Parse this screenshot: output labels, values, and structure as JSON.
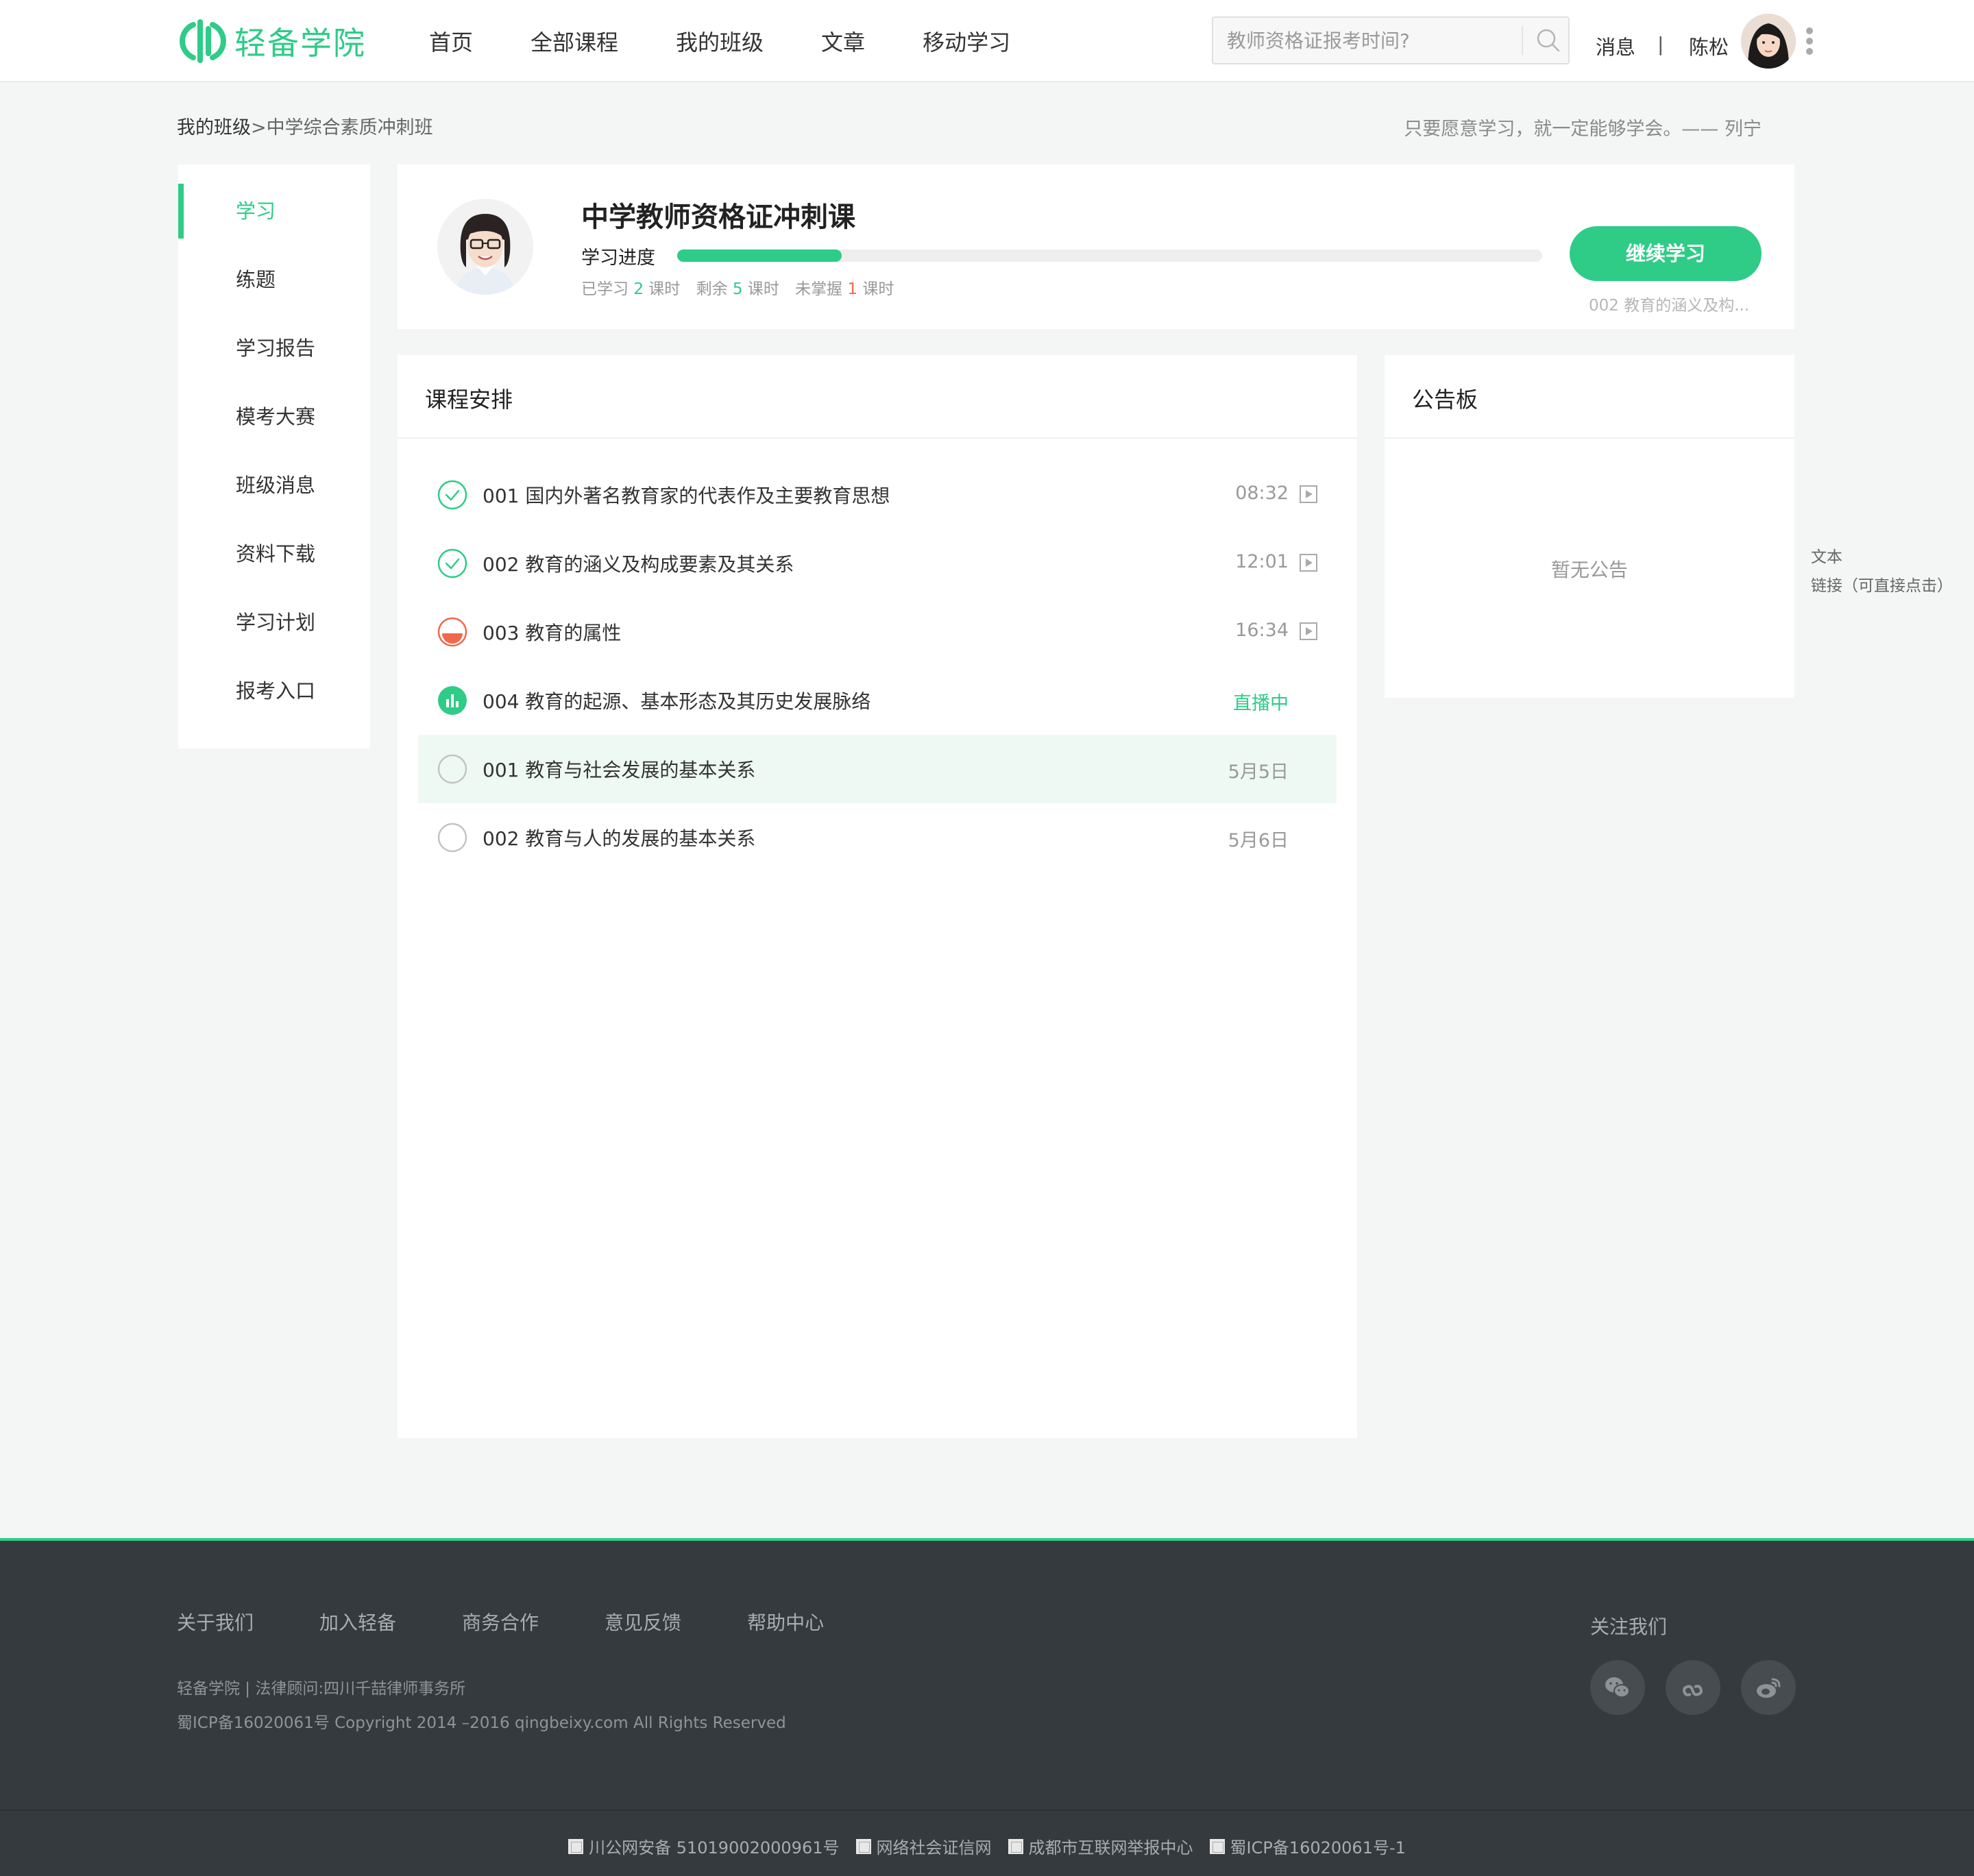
{
  "brand": {
    "name": "轻备学院",
    "color": "#2ecc87"
  },
  "nav": {
    "items": [
      "首页",
      "全部课程",
      "我的班级",
      "文章",
      "移动学习"
    ]
  },
  "search": {
    "placeholder": "教师资格证报考时间?"
  },
  "user": {
    "messages_label": "消息",
    "separator": "|",
    "name": "陈松"
  },
  "breadcrumb": {
    "home": "我的班级",
    "sep": ">",
    "current": "中学综合素质冲刺班"
  },
  "quote": "只要愿意学习，就一定能够学会。—— 列宁",
  "sidebar": {
    "items": [
      {
        "label": "学习",
        "active": true
      },
      {
        "label": "练题"
      },
      {
        "label": "学习报告"
      },
      {
        "label": "模考大赛"
      },
      {
        "label": "班级消息"
      },
      {
        "label": "资料下载"
      },
      {
        "label": "学习计划"
      },
      {
        "label": "报考入口"
      }
    ]
  },
  "course": {
    "title": "中学教师资格证冲刺课",
    "progress_label": "学习进度",
    "progress_fraction": 0.19,
    "stats": {
      "learned_prefix": "已学习",
      "learned": "2",
      "unit1": "课时",
      "remain_prefix": "剩余",
      "remain": "5",
      "unit2": "课时",
      "weak_prefix": "未掌握",
      "weak": "1",
      "unit3": "课时"
    },
    "continue_label": "继续学习",
    "continue_sub": "002 教育的涵义及构..."
  },
  "schedule": {
    "title": "课程安排",
    "lessons": [
      {
        "title": "001 国内外著名教育家的代表作及主要教育思想",
        "meta": "08:32",
        "status": "done",
        "play": true
      },
      {
        "title": "002 教育的涵义及构成要素及其关系",
        "meta": "12:01",
        "status": "done",
        "play": true
      },
      {
        "title": "003 教育的属性",
        "meta": "16:34",
        "status": "partial",
        "play": true
      },
      {
        "title": "004 教育的起源、基本形态及其历史发展脉络",
        "meta": "直播中",
        "status": "live",
        "play": false
      },
      {
        "title": "001 教育与社会发展的基本关系",
        "meta": "5月5日",
        "status": "todo",
        "play": false,
        "highlight": true
      },
      {
        "title": "002 教育与人的发展的基本关系",
        "meta": "5月6日",
        "status": "todo",
        "play": false
      }
    ]
  },
  "notice": {
    "title": "公告板",
    "empty": "暂无公告"
  },
  "side_note": {
    "line1": "文本",
    "line2": "链接（可直接点击）"
  },
  "footer": {
    "links": [
      "关于我们",
      "加入轻备",
      "商务合作",
      "意见反馈",
      "帮助中心"
    ],
    "info1": "轻备学院 | 法律顾问:四川千喆律师事务所",
    "info2": "蜀ICP备16020061号 Copyright 2014 –2016 qingbeixy.com All Rights Reserved",
    "follow_title": "关注我们",
    "social_icons": [
      "wechat-icon",
      "miniprogram-icon",
      "weibo-icon"
    ],
    "badges": [
      "川公网安备 51019002000961号",
      "网络社会证信网",
      "成都市互联网举报中心",
      "蜀ICP备16020061号-1"
    ]
  }
}
